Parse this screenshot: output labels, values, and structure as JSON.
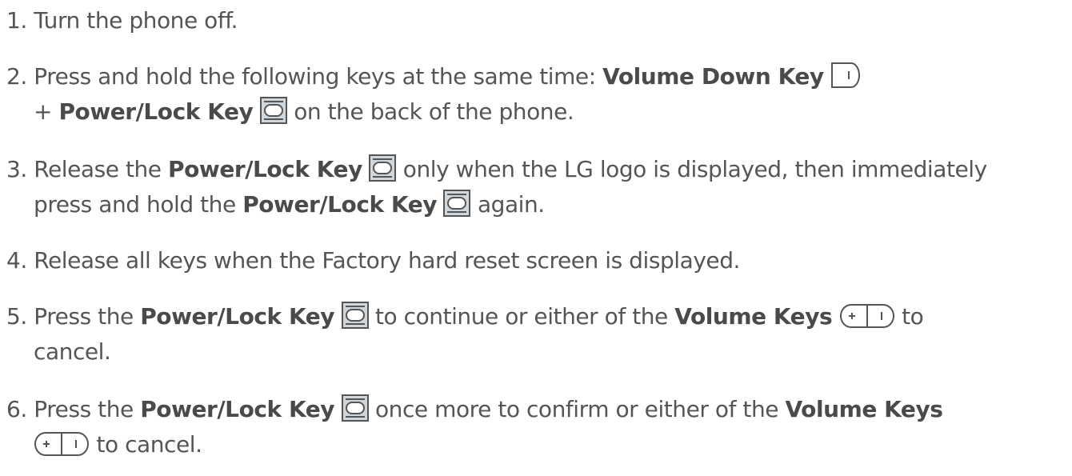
{
  "steps": [
    {
      "num": "1.",
      "text": "Turn the phone off."
    },
    {
      "num": "2.",
      "t1": "Press and hold the following keys at the same time:",
      "b1": "Volume Down Key",
      "t2": "+",
      "b2": "Power/Lock Key",
      "t3": "on the back of the phone."
    },
    {
      "num": "3.",
      "t1": "Release the",
      "b1": "Power/Lock Key",
      "t2": "only when the LG logo is displayed, then immediately",
      "t3": "press and hold the",
      "b2": "Power/Lock Key",
      "t4": "again."
    },
    {
      "num": "4.",
      "text": "Release all keys when the Factory hard reset screen is displayed."
    },
    {
      "num": "5.",
      "t1": "Press the",
      "b1": "Power/Lock Key",
      "t2": "to continue or either of the",
      "b2": "Volume Keys",
      "t3": "to",
      "t4": "cancel."
    },
    {
      "num": "6.",
      "t1": "Press the",
      "b1": "Power/Lock Key",
      "t2": "once more to confirm or either of the",
      "b2": "Volume Keys",
      "t3": "to cancel."
    }
  ],
  "icons": {
    "volume_down_key": "volume-down-key-icon",
    "power_lock_key": "power-lock-key-icon",
    "volume_keys": "volume-keys-icon"
  },
  "colors": {
    "text": "#555555",
    "icon_stroke": "#555555",
    "power_key_fill": "#cfd6dc"
  }
}
